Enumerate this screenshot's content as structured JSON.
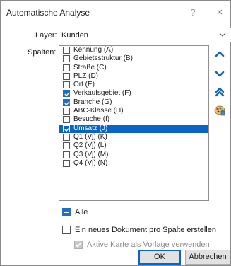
{
  "window": {
    "title": "Automatische Analyse",
    "help_glyph": "?",
    "close_glyph": "×"
  },
  "layer": {
    "label": "Layer:",
    "value": "Kunden"
  },
  "columns": {
    "label": "Spalten:",
    "items": [
      {
        "label": "Kennung (A)",
        "checked": false,
        "selected": false
      },
      {
        "label": "Gebietsstruktur (B)",
        "checked": false,
        "selected": false
      },
      {
        "label": "Straße (C)",
        "checked": false,
        "selected": false
      },
      {
        "label": "PLZ (D)",
        "checked": false,
        "selected": false
      },
      {
        "label": "Ort (E)",
        "checked": false,
        "selected": false
      },
      {
        "label": "Verkaufsgebiet (F)",
        "checked": true,
        "selected": false
      },
      {
        "label": "Branche (G)",
        "checked": true,
        "selected": false
      },
      {
        "label": "ABC-Klasse (H)",
        "checked": false,
        "selected": false
      },
      {
        "label": "Besuche (I)",
        "checked": false,
        "selected": false
      },
      {
        "label": "Umsatz (J)",
        "checked": true,
        "selected": true
      },
      {
        "label": "Q1 (Vj) (K)",
        "checked": false,
        "selected": false
      },
      {
        "label": "Q2 (Vj) (L)",
        "checked": false,
        "selected": false
      },
      {
        "label": "Q3 (Vj) (M)",
        "checked": false,
        "selected": false
      },
      {
        "label": "Q4 (Vj) (N)",
        "checked": false,
        "selected": false
      }
    ]
  },
  "side_buttons": {
    "move_up_icon": "chevron-up-icon",
    "move_down_icon": "chevron-down-icon",
    "move_top_icon": "double-chevron-up-icon",
    "colors_icon": "color-palette-icon"
  },
  "options": {
    "all_label": "Alle",
    "new_doc_label": "Ein neues Dokument pro Spalte erstellen",
    "template_label": "Aktive Karte als Vorlage verwenden"
  },
  "buttons": {
    "ok_accel": "O",
    "ok_rest": "K",
    "cancel_accel": "A",
    "cancel_rest": "bbrechen"
  },
  "colors": {
    "accent": "#1f6fc4",
    "selection": "#0a63c8",
    "chevron": "#1565c0"
  }
}
